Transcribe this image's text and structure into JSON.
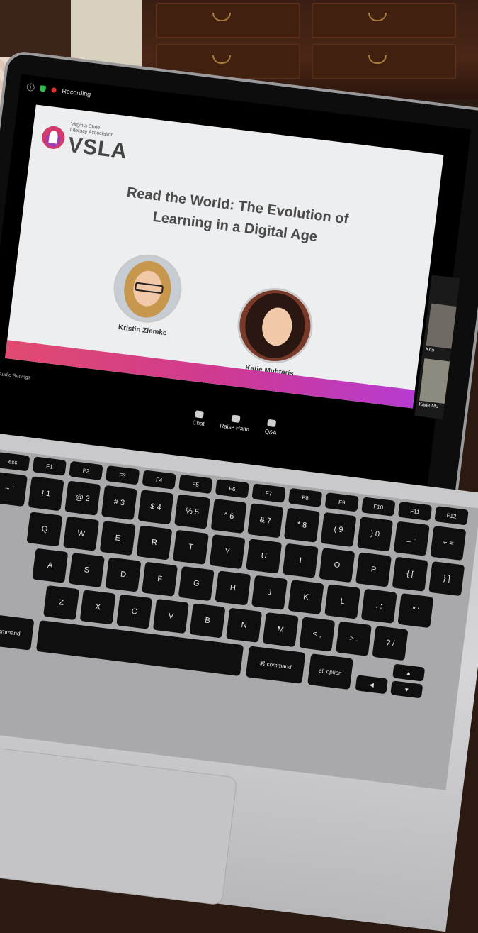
{
  "zoom": {
    "recording_label": "Recording",
    "audio_settings": "Audio Settings",
    "controls": [
      {
        "label": "Chat",
        "icon": "chat-icon"
      },
      {
        "label": "Raise Hand",
        "icon": "raise-hand-icon"
      },
      {
        "label": "Q&A",
        "icon": "qa-icon"
      }
    ],
    "participants": [
      "Kris",
      "Katie Mu"
    ]
  },
  "slide": {
    "org_small_line1": "Virginia State",
    "org_small_line2": "Literacy Association",
    "org_abbrev": "VSLA",
    "title_line1": "Read the World: The Evolution of",
    "title_line2": "Learning in a Digital Age",
    "speakers": [
      {
        "name": "Kristin Ziemke"
      },
      {
        "name": "Katie Muhtaris"
      }
    ],
    "stripe_colors": [
      "#e04b6f",
      "#b63bd0"
    ]
  },
  "keyboard": {
    "row0": [
      "esc",
      "F1",
      "F2",
      "F3",
      "F4",
      "F5",
      "F6",
      "F7",
      "F8",
      "F9",
      "F10",
      "F11",
      "F12"
    ],
    "row1": [
      "~ `",
      "! 1",
      "@ 2",
      "# 3",
      "$ 4",
      "% 5",
      "^ 6",
      "& 7",
      "* 8",
      "( 9",
      ") 0",
      "_ -",
      "+ ="
    ],
    "row2": [
      "Q",
      "W",
      "E",
      "R",
      "T",
      "Y",
      "U",
      "I",
      "O",
      "P",
      "{ [",
      "} ]"
    ],
    "row3": [
      "A",
      "S",
      "D",
      "F",
      "G",
      "H",
      "J",
      "K",
      "L",
      ": ;",
      "\" '"
    ],
    "row4": [
      "Z",
      "X",
      "C",
      "V",
      "B",
      "N",
      "M",
      "< ,",
      "> .",
      "? /"
    ],
    "command_left": "command",
    "command_right": "command",
    "option": "option",
    "alt": "alt",
    "cmd_symbol": "⌘"
  }
}
